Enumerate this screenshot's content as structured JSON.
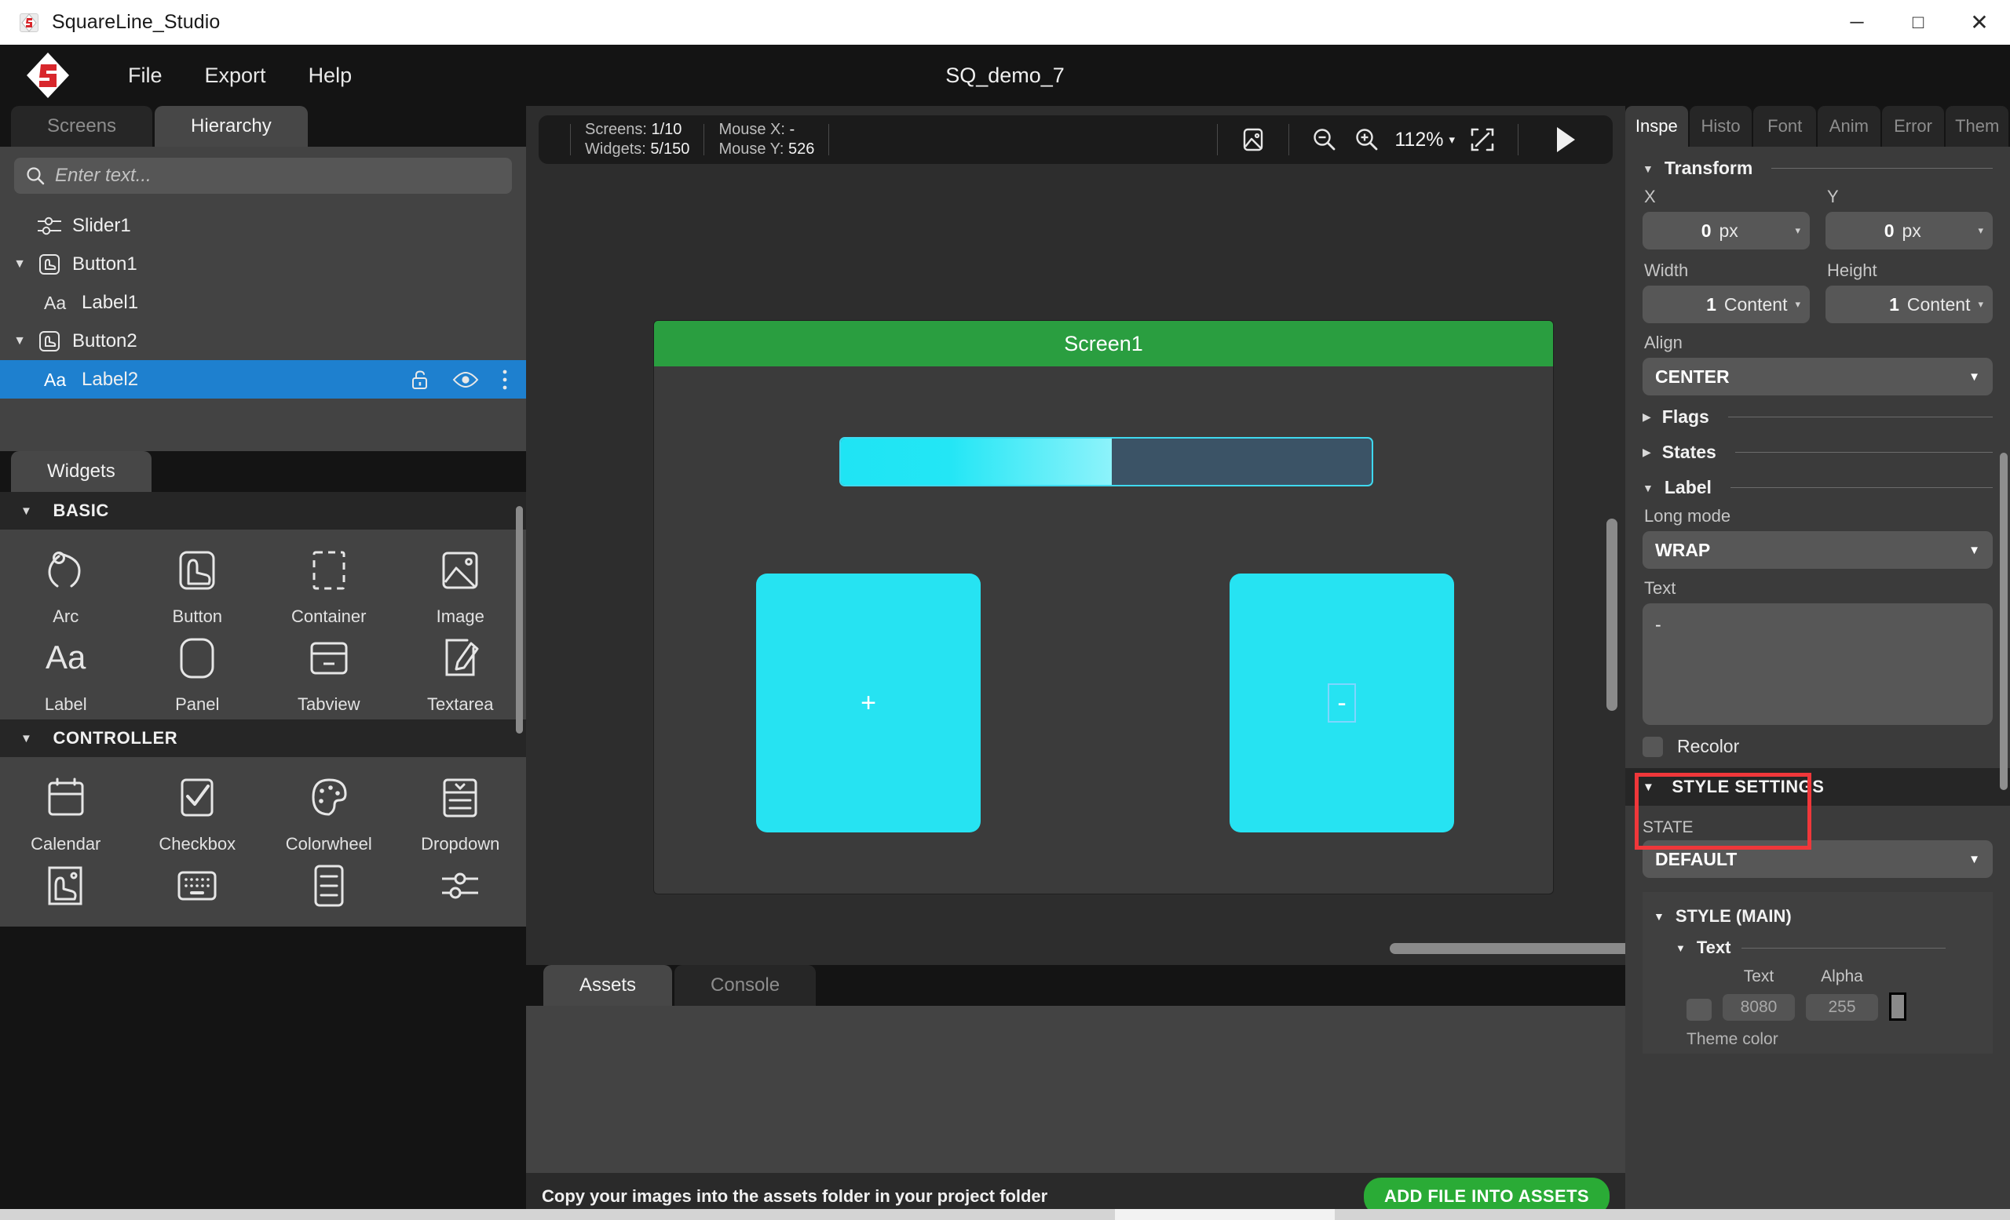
{
  "window": {
    "title": "SquareLine_Studio",
    "minimize": "─",
    "maximize": "□",
    "close": "✕"
  },
  "menu": {
    "items": [
      {
        "label": "File"
      },
      {
        "label": "Export"
      },
      {
        "label": "Help"
      }
    ],
    "project_title": "SQ_demo_7"
  },
  "left_panel": {
    "tabs": [
      {
        "label": "Screens",
        "active": false
      },
      {
        "label": "Hierarchy",
        "active": true
      }
    ],
    "search": {
      "placeholder": "Enter text...",
      "value": "",
      "icon": "search-icon"
    },
    "tree": [
      {
        "name": "Slider1",
        "icon": "slider-icon",
        "indent": 0,
        "caret": "",
        "selected": false
      },
      {
        "name": "Button1",
        "icon": "button-icon",
        "indent": 0,
        "caret": "▼",
        "selected": false
      },
      {
        "name": "Label1",
        "icon": "label-icon",
        "indent": 1,
        "caret": "",
        "selected": false
      },
      {
        "name": "Button2",
        "icon": "button-icon",
        "indent": 0,
        "caret": "▼",
        "selected": false
      },
      {
        "name": "Label2",
        "icon": "label-icon",
        "indent": 1,
        "caret": "",
        "selected": true
      }
    ],
    "row_actions": [
      "unlock-icon",
      "eye-icon",
      "more-vertical-icon"
    ]
  },
  "widgets_panel": {
    "tabs": [
      {
        "label": "Widgets",
        "active": true
      }
    ],
    "groups": [
      {
        "title": "BASIC",
        "caret": "▼",
        "items": [
          {
            "label": "Arc",
            "icon": "arc-icon"
          },
          {
            "label": "Button",
            "icon": "button-icon"
          },
          {
            "label": "Container",
            "icon": "container-icon"
          },
          {
            "label": "Image",
            "icon": "image-icon"
          },
          {
            "label": "Label",
            "icon": "label-icon"
          },
          {
            "label": "Panel",
            "icon": "panel-icon"
          },
          {
            "label": "Tabview",
            "icon": "tabview-icon"
          },
          {
            "label": "Textarea",
            "icon": "textarea-icon"
          }
        ]
      },
      {
        "title": "CONTROLLER",
        "caret": "▼",
        "items": [
          {
            "label": "Calendar",
            "icon": "calendar-icon"
          },
          {
            "label": "Checkbox",
            "icon": "checkbox-icon"
          },
          {
            "label": "Colorwheel",
            "icon": "colorwheel-icon"
          },
          {
            "label": "Dropdown",
            "icon": "dropdown-icon"
          },
          {
            "label": "",
            "icon": "imagebutton-icon"
          },
          {
            "label": "",
            "icon": "keyboard-icon"
          },
          {
            "label": "",
            "icon": "list-icon"
          },
          {
            "label": "",
            "icon": "slider-icon"
          }
        ]
      }
    ]
  },
  "canvas_toolbar": {
    "screens_label": "Screens:",
    "screens_value": "1/10",
    "widgets_label": "Widgets:",
    "widgets_value": "5/150",
    "mouse_x_label": "Mouse X:",
    "mouse_x_value": "-",
    "mouse_y_label": "Mouse Y:",
    "mouse_y_value": "526",
    "image_icon": "image-preview-icon",
    "zoom_out_icon": "zoom-out-icon",
    "zoom_in_icon": "zoom-in-icon",
    "zoom_value": "112%",
    "zoom_caret": "▾",
    "fit_icon": "fit-screen-icon",
    "play_icon": "play-icon"
  },
  "canvas": {
    "screen_title": "Screen1",
    "slider_fill_percent": 51,
    "button_left_label": "+",
    "button_right_label": "-"
  },
  "assets_panel": {
    "tabs": [
      {
        "label": "Assets",
        "active": true
      },
      {
        "label": "Console",
        "active": false
      }
    ],
    "hint": "Copy your images into the assets folder in your project folder",
    "add_button": "ADD FILE INTO ASSETS"
  },
  "inspector": {
    "tabs": [
      {
        "label": "Inspe",
        "active": true
      },
      {
        "label": "Histo",
        "active": false
      },
      {
        "label": "Font",
        "active": false
      },
      {
        "label": "Anim",
        "active": false
      },
      {
        "label": "Error",
        "active": false
      },
      {
        "label": "Them",
        "active": false
      }
    ],
    "transform": {
      "title": "Transform",
      "caret": "▼",
      "x_label": "X",
      "x_value": "0",
      "x_unit": "px",
      "y_label": "Y",
      "y_value": "0",
      "y_unit": "px",
      "width_label": "Width",
      "width_value": "1",
      "width_unit": "Content",
      "height_label": "Height",
      "height_value": "1",
      "height_unit": "Content",
      "align_label": "Align",
      "align_value": "CENTER"
    },
    "flags": {
      "title": "Flags",
      "caret": "▶"
    },
    "states": {
      "title": "States",
      "caret": "▶"
    },
    "label_section": {
      "title": "Label",
      "caret": "▼",
      "long_mode_label": "Long mode",
      "long_mode_value": "WRAP",
      "text_label": "Text",
      "text_value": "-",
      "recolor_label": "Recolor",
      "recolor_checked": false
    },
    "style_settings": {
      "title": "STYLE SETTINGS",
      "caret": "▼",
      "state_label": "STATE",
      "state_value": "DEFAULT",
      "style_main_title": "STYLE (MAIN)",
      "style_main_caret": "▼",
      "text_group_title": "Text",
      "text_group_caret": "▼",
      "text_color_label": "Text",
      "text_color_value": "8080",
      "alpha_label": "Alpha",
      "alpha_value": "255",
      "theme_color_label": "Theme color"
    }
  },
  "colors": {
    "accent_blue": "#1e80cf",
    "highlight_red": "#f0373a",
    "screen_green": "#2a9e40",
    "widget_cyan": "#26e3f2",
    "panel_bg": "#3b3b3b",
    "dark_bg": "#141414",
    "add_button_green": "#2aab36"
  }
}
